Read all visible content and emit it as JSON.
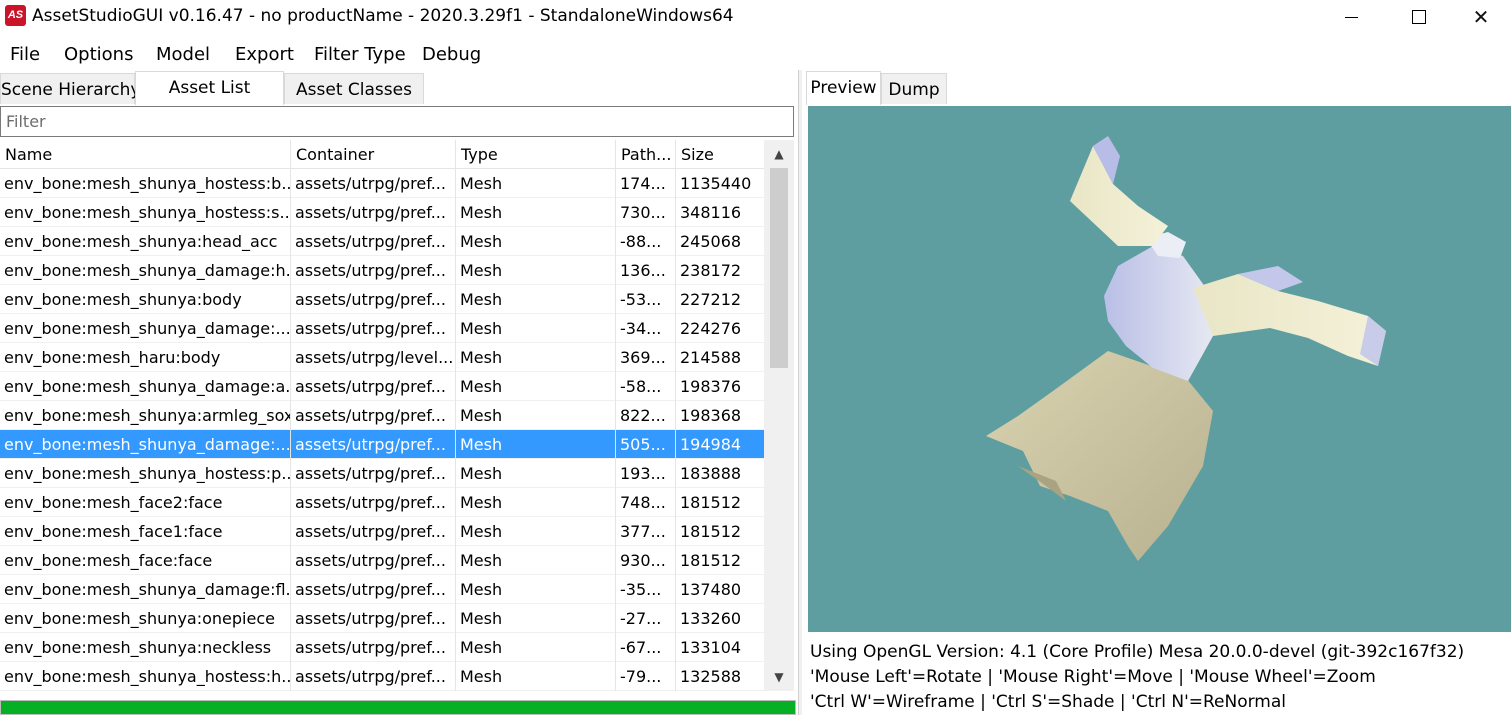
{
  "window": {
    "app_icon": "AS",
    "title": "AssetStudioGUI v0.16.47 - no productName - 2020.3.29f1 - StandaloneWindows64"
  },
  "menu": [
    "File",
    "Options",
    "Model",
    "Export",
    "Filter Type",
    "Debug"
  ],
  "left_tabs": [
    {
      "label": "Scene Hierarchy",
      "active": false
    },
    {
      "label": "Asset List",
      "active": true
    },
    {
      "label": "Asset Classes",
      "active": false
    }
  ],
  "filter": {
    "placeholder": "Filter",
    "value": ""
  },
  "table": {
    "columns": [
      "Name",
      "Container",
      "Type",
      "Path...",
      "Size"
    ],
    "rows": [
      {
        "name": "env_bone:mesh_shunya_hostess:b...",
        "container": "assets/utrpg/pref...",
        "type": "Mesh",
        "path": "174...",
        "size": "1135440"
      },
      {
        "name": "env_bone:mesh_shunya_hostess:s...",
        "container": "assets/utrpg/pref...",
        "type": "Mesh",
        "path": "730...",
        "size": "348116"
      },
      {
        "name": "env_bone:mesh_shunya:head_acc",
        "container": "assets/utrpg/pref...",
        "type": "Mesh",
        "path": "-88...",
        "size": "245068"
      },
      {
        "name": "env_bone:mesh_shunya_damage:h...",
        "container": "assets/utrpg/pref...",
        "type": "Mesh",
        "path": "136...",
        "size": "238172"
      },
      {
        "name": "env_bone:mesh_shunya:body",
        "container": "assets/utrpg/pref...",
        "type": "Mesh",
        "path": "-53...",
        "size": "227212"
      },
      {
        "name": "env_bone:mesh_shunya_damage:...",
        "container": "assets/utrpg/pref...",
        "type": "Mesh",
        "path": "-34...",
        "size": "224276"
      },
      {
        "name": "env_bone:mesh_haru:body",
        "container": "assets/utrpg/level...",
        "type": "Mesh",
        "path": "369...",
        "size": "214588"
      },
      {
        "name": "env_bone:mesh_shunya_damage:a...",
        "container": "assets/utrpg/pref...",
        "type": "Mesh",
        "path": "-58...",
        "size": "198376"
      },
      {
        "name": "env_bone:mesh_shunya:armleg_sox",
        "container": "assets/utrpg/pref...",
        "type": "Mesh",
        "path": "822...",
        "size": "198368"
      },
      {
        "name": "env_bone:mesh_shunya_damage:...",
        "container": "assets/utrpg/pref...",
        "type": "Mesh",
        "path": "505...",
        "size": "194984",
        "selected": true
      },
      {
        "name": "env_bone:mesh_shunya_hostess:p...",
        "container": "assets/utrpg/pref...",
        "type": "Mesh",
        "path": "193...",
        "size": "183888"
      },
      {
        "name": "env_bone:mesh_face2:face",
        "container": "assets/utrpg/pref...",
        "type": "Mesh",
        "path": "748...",
        "size": "181512"
      },
      {
        "name": "env_bone:mesh_face1:face",
        "container": "assets/utrpg/pref...",
        "type": "Mesh",
        "path": "377...",
        "size": "181512"
      },
      {
        "name": "env_bone:mesh_face:face",
        "container": "assets/utrpg/pref...",
        "type": "Mesh",
        "path": "930...",
        "size": "181512"
      },
      {
        "name": "env_bone:mesh_shunya_damage:fl...",
        "container": "assets/utrpg/pref...",
        "type": "Mesh",
        "path": "-35...",
        "size": "137480"
      },
      {
        "name": "env_bone:mesh_shunya:onepiece",
        "container": "assets/utrpg/pref...",
        "type": "Mesh",
        "path": "-27...",
        "size": "133260"
      },
      {
        "name": "env_bone:mesh_shunya:neckless",
        "container": "assets/utrpg/pref...",
        "type": "Mesh",
        "path": "-67...",
        "size": "133104"
      },
      {
        "name": "env_bone:mesh_shunya_hostess:h...",
        "container": "assets/utrpg/pref...",
        "type": "Mesh",
        "path": "-79...",
        "size": "132588"
      }
    ]
  },
  "progress": {
    "value": 1.0,
    "color": "#06b025"
  },
  "right_tabs": [
    {
      "label": "Preview",
      "active": true
    },
    {
      "label": "Dump",
      "active": false
    }
  ],
  "preview": {
    "background": "#5f9ea0"
  },
  "info_lines": [
    "Using OpenGL Version: 4.1 (Core Profile) Mesa 20.0.0-devel (git-392c167f32)",
    "'Mouse Left'=Rotate | 'Mouse Right'=Move | 'Mouse Wheel'=Zoom",
    "'Ctrl W'=Wireframe | 'Ctrl S'=Shade | 'Ctrl N'=ReNormal"
  ],
  "icons": {
    "minimize": "minimize-icon",
    "maximize": "maximize-icon",
    "close": "close-icon",
    "scroll_up": "chevron-up-icon",
    "scroll_down": "chevron-down-icon"
  },
  "glyphs": {
    "close": "✕",
    "up": "▲",
    "down": "▼"
  }
}
